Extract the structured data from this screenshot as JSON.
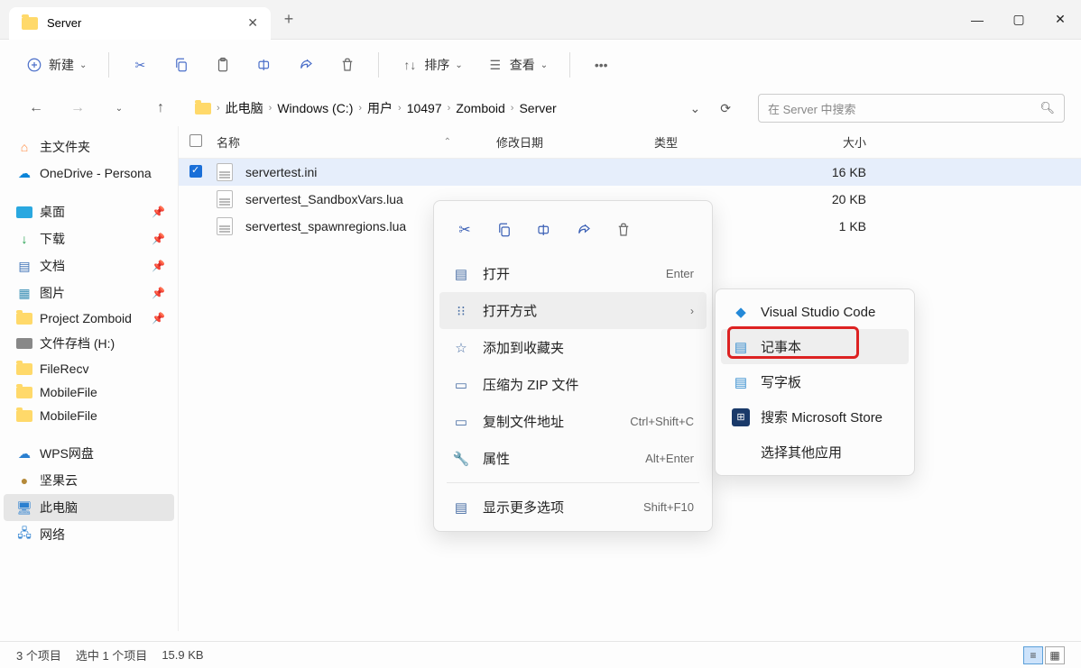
{
  "titlebar": {
    "tab_title": "Server"
  },
  "toolbar": {
    "new_label": "新建",
    "sort_label": "排序",
    "view_label": "查看"
  },
  "breadcrumb": {
    "parts": [
      "此电脑",
      "Windows (C:)",
      "用户",
      "10497",
      "Zomboid",
      "Server"
    ]
  },
  "search": {
    "placeholder": "在 Server 中搜索"
  },
  "sidebar": {
    "home": "主文件夹",
    "onedrive": "OneDrive - Persona",
    "quick": [
      {
        "label": "桌面"
      },
      {
        "label": "下载"
      },
      {
        "label": "文档"
      },
      {
        "label": "图片"
      },
      {
        "label": "Project Zomboid"
      },
      {
        "label": "文件存档 (H:)"
      },
      {
        "label": "FileRecv"
      },
      {
        "label": "MobileFile"
      },
      {
        "label": "MobileFile"
      }
    ],
    "wps": "WPS网盘",
    "nut": "坚果云",
    "pc": "此电脑",
    "net": "网络"
  },
  "columns": {
    "name": "名称",
    "date": "修改日期",
    "type": "类型",
    "size": "大小"
  },
  "files": [
    {
      "name": "servertest.ini",
      "size": "16 KB",
      "selected": true
    },
    {
      "name": "servertest_SandboxVars.lua",
      "size": "20 KB",
      "selected": false
    },
    {
      "name": "servertest_spawnregions.lua",
      "size": "1 KB",
      "selected": false
    }
  ],
  "context": {
    "open": "打开",
    "open_k": "Enter",
    "openwith": "打开方式",
    "fav": "添加到收藏夹",
    "zip": "压缩为 ZIP 文件",
    "copypath": "复制文件地址",
    "copypath_k": "Ctrl+Shift+C",
    "props": "属性",
    "props_k": "Alt+Enter",
    "more": "显示更多选项",
    "more_k": "Shift+F10"
  },
  "submenu": {
    "vscode": "Visual Studio Code",
    "notepad": "记事本",
    "wordpad": "写字板",
    "store": "搜索 Microsoft Store",
    "other": "选择其他应用"
  },
  "status": {
    "count": "3 个项目",
    "sel": "选中 1 个项目",
    "size": "15.9 KB"
  }
}
